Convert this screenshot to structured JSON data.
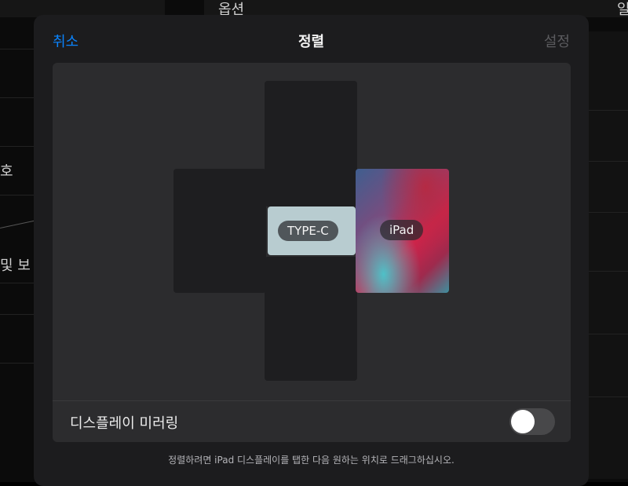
{
  "background": {
    "header_text": "옵션",
    "header_text_right": "일",
    "left_texts": [
      "호",
      "및 보"
    ]
  },
  "sheet": {
    "cancel_label": "취소",
    "title": "정렬",
    "confirm_label": "설정",
    "confirm_enabled": false,
    "accent_color": "#0a84ff"
  },
  "arrangement": {
    "displays": [
      {
        "name": "external-left"
      },
      {
        "name": "external-top"
      },
      {
        "name": "external-bottom"
      },
      {
        "name": "type-c",
        "label": "TYPE-C"
      },
      {
        "name": "ipad",
        "label": "iPad"
      }
    ]
  },
  "mirroring": {
    "label": "디스플레이 미러링",
    "enabled": false
  },
  "hint": "정렬하려면 iPad 디스플레이를 탭한 다음 원하는 위치로 드래그하십시오."
}
